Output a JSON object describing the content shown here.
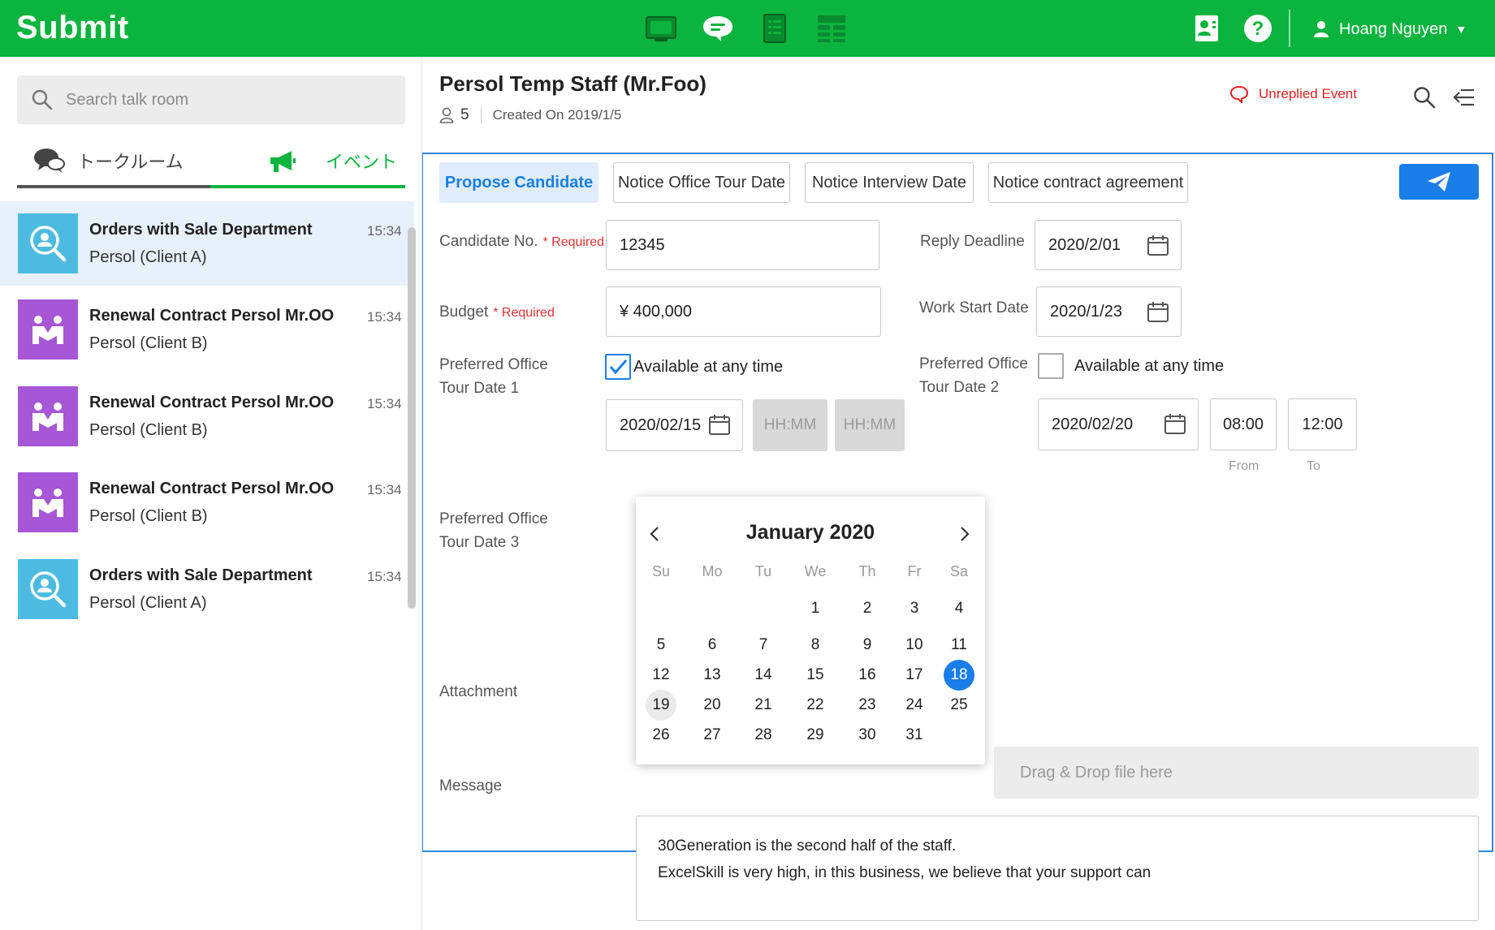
{
  "topbar": {
    "brand": "Submit",
    "nav_icons": [
      "dashboard-icon",
      "chat-icon",
      "clipboard-list-icon",
      "table-grid-icon"
    ],
    "user_name": "Hoang Nguyen",
    "accent": "#0bb43e"
  },
  "sidebar": {
    "search_placeholder": "Search talk room",
    "tabs": [
      {
        "label": "トークルーム",
        "active": false
      },
      {
        "label": "イベント",
        "active": true
      }
    ],
    "rooms": [
      {
        "title": "Orders with Sale Department",
        "sub": "Persol (Client A)",
        "time": "15:34",
        "icon": "search-person-icon",
        "color": "#4dbbe0",
        "active": true
      },
      {
        "title": "Renewal Contract Persol Mr.OO",
        "sub": "Persol (Client B)",
        "time": "15:34",
        "icon": "handshake-icon",
        "color": "#a656d6",
        "active": false
      },
      {
        "title": "Renewal Contract Persol Mr.OO",
        "sub": "Persol (Client B)",
        "time": "15:34",
        "icon": "handshake-icon",
        "color": "#a656d6",
        "active": false
      },
      {
        "title": "Renewal Contract Persol Mr.OO",
        "sub": "Persol (Client B)",
        "time": "15:34",
        "icon": "handshake-icon",
        "color": "#a656d6",
        "active": false
      },
      {
        "title": "Orders with Sale Department",
        "sub": "Persol (Client A)",
        "time": "15:34",
        "icon": "search-person-icon",
        "color": "#4dbbe0",
        "active": false
      }
    ]
  },
  "main": {
    "title": "Persol Temp Staff (Mr.Foo)",
    "member_count": "5",
    "created": "Created On 2019/1/5",
    "unreplied": "Unreplied Event",
    "tabs": [
      {
        "label": "Propose Candidate",
        "active": true
      },
      {
        "label": "Notice Office Tour Date",
        "active": false
      },
      {
        "label": "Notice Interview Date",
        "active": false
      },
      {
        "label": "Notice contract agreement",
        "active": false
      }
    ]
  },
  "form": {
    "required_text": "* Required",
    "candidate_label": "Candidate No.",
    "candidate_value": "12345",
    "budget_label": "Budget",
    "budget_value": "¥ 400,000",
    "reply_deadline_label": "Reply Deadline",
    "reply_deadline_value": "2020/2/01",
    "work_start_label": "Work Start Date",
    "work_start_value": "2020/1/23",
    "tour1_label_line1": "Preferred Office",
    "tour1_label_line2": "Tour Date 1",
    "tour1_any_time": "Available at any time",
    "tour1_any_time_checked": true,
    "tour1_date": "2020/02/15",
    "tour1_from_placeholder": "HH:MM",
    "tour1_to_placeholder": "HH:MM",
    "tour2_label_line1": "Preferred Office",
    "tour2_label_line2": "Tour Date 2",
    "tour2_any_time": "Available at any time",
    "tour2_any_time_checked": false,
    "tour2_date": "2020/02/20",
    "tour2_from": "08:00",
    "tour2_to": "12:00",
    "from_label": "From",
    "to_label": "To",
    "tour3_label_line1": "Preferred Office",
    "tour3_label_line2": "Tour Date 3",
    "attachment_label": "Attachment",
    "dropzone_text": "Drag & Drop file here",
    "message_label": "Message",
    "message_line1": "30Generation is the second half of the staff.",
    "message_line2": "ExcelSkill is very high, in this business, we believe that your support can"
  },
  "calendar": {
    "month_label": "January 2020",
    "weekdays": [
      "Su",
      "Mo",
      "Tu",
      "We",
      "Th",
      "Fr",
      "Sa"
    ],
    "first_weekday_index": 3,
    "days_in_month": 31,
    "selected_day": 18,
    "hover_day": 19
  }
}
